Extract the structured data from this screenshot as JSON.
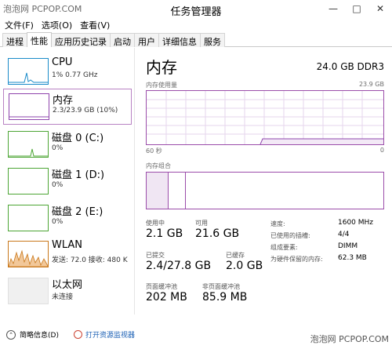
{
  "watermark": {
    "top": "泡泡网 PCPOP.COM",
    "bottom": "泡泡网 PCPOP.COM"
  },
  "window": {
    "title": "任务管理器"
  },
  "menu": [
    "文件(F)",
    "选项(O)",
    "查看(V)"
  ],
  "tabs": [
    "进程",
    "性能",
    "应用历史记录",
    "启动",
    "用户",
    "详细信息",
    "服务"
  ],
  "active_tab": "性能",
  "sidebar": [
    {
      "name": "CPU",
      "sub": "1% 0.77 GHz"
    },
    {
      "name": "内存",
      "sub": "2.3/23.9 GB (10%)"
    },
    {
      "name": "磁盘 0 (C:)",
      "sub": "0%"
    },
    {
      "name": "磁盘 1 (D:)",
      "sub": "0%"
    },
    {
      "name": "磁盘 2 (E:)",
      "sub": "0%"
    },
    {
      "name": "WLAN",
      "sub": "发送: 72.0  接收: 480 K"
    },
    {
      "name": "以太网",
      "sub": "未连接"
    }
  ],
  "colors": {
    "cpu": "#1a8bc9",
    "memory": "#8e44ad",
    "disk": "#4ca534",
    "wlan": "#c9771a",
    "ethernet": "#9e9e9e"
  },
  "main": {
    "title": "内存",
    "total": "24.0 GB DDR3",
    "usage_label": "内存使用量",
    "usage_max": "23.9 GB",
    "time_left": "60 秒",
    "time_right": "0",
    "composition_label": "内存组合",
    "stats": {
      "in_use_label": "使用中",
      "in_use": "2.1 GB",
      "available_label": "可用",
      "available": "21.6 GB",
      "committed_label": "已提交",
      "committed": "2.4/27.8 GB",
      "cached_label": "已缓存",
      "cached": "2.0 GB",
      "paged_label": "页面缓冲池",
      "paged": "202 MB",
      "nonpaged_label": "非页面缓冲池",
      "nonpaged": "85.9 MB"
    },
    "details": [
      {
        "label": "速度:",
        "value": "1600 MHz"
      },
      {
        "label": "已使用的插槽:",
        "value": "4/4"
      },
      {
        "label": "组成要素:",
        "value": "DIMM"
      },
      {
        "label": "为硬件保留的内存:",
        "value": "62.3 MB"
      }
    ]
  },
  "footer": {
    "summary": "简略信息(D)",
    "monitor": "打开资源监视器"
  }
}
